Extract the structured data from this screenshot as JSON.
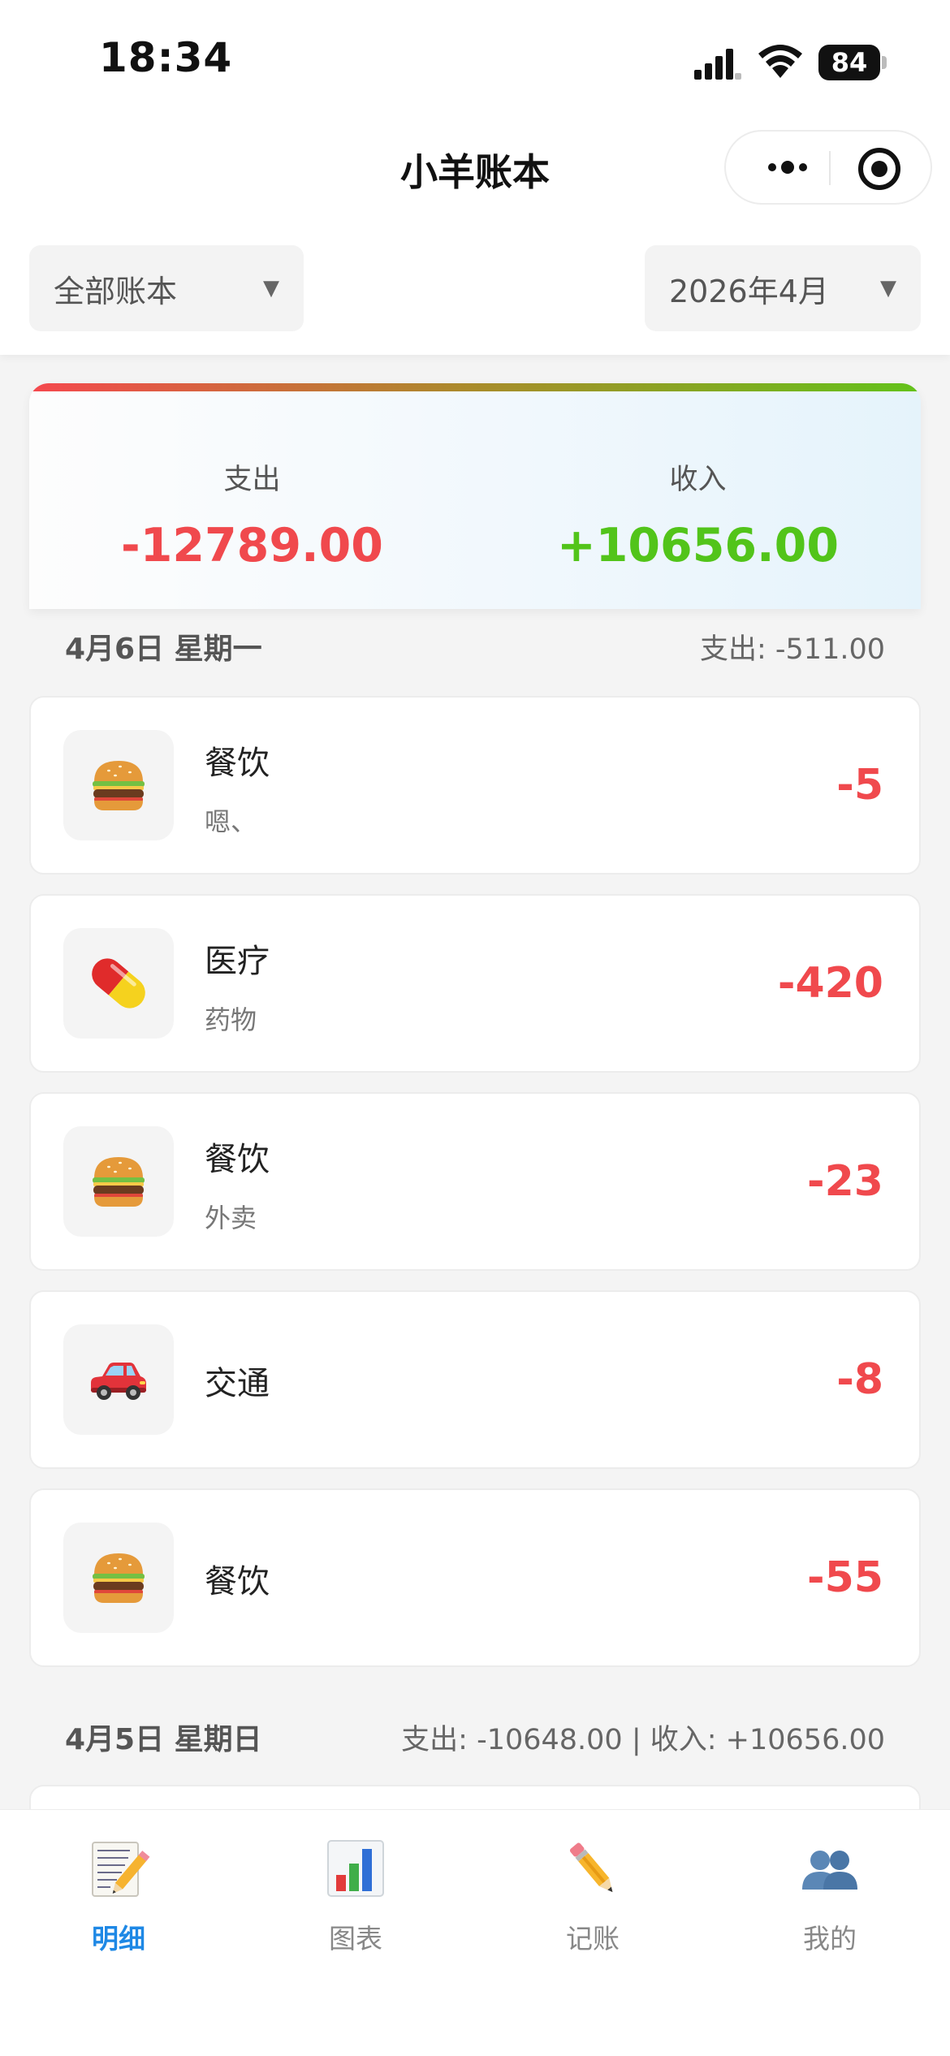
{
  "status_bar": {
    "time": "18:34",
    "battery": "84"
  },
  "nav": {
    "title": "小羊账本"
  },
  "filters": {
    "book": "全部账本",
    "month": "2026年4月"
  },
  "summary": {
    "expense_label": "支出",
    "expense_value": "-12789.00",
    "income_label": "收入",
    "income_value": "+10656.00"
  },
  "days": [
    {
      "date": "4月6日 星期一",
      "summary": "支出: -511.00",
      "records": [
        {
          "category": "餐饮",
          "note": "嗯、",
          "amount": "-5",
          "icon": "hamburger-icon"
        },
        {
          "category": "医疗",
          "note": "药物",
          "amount": "-420",
          "icon": "pill-icon"
        },
        {
          "category": "餐饮",
          "note": "外卖",
          "amount": "-23",
          "icon": "hamburger-icon"
        },
        {
          "category": "交通",
          "note": "",
          "amount": "-8",
          "icon": "car-icon"
        },
        {
          "category": "餐饮",
          "note": "",
          "amount": "-55",
          "icon": "hamburger-icon"
        }
      ]
    },
    {
      "date": "4月5日 星期日",
      "summary": "支出: -10648.00 | 收入: +10656.00",
      "records": []
    }
  ],
  "tabs": [
    {
      "label": "明细",
      "icon": "memo-icon",
      "active": true
    },
    {
      "label": "图表",
      "icon": "bar-chart-icon",
      "active": false
    },
    {
      "label": "记账",
      "icon": "pencil-icon",
      "active": false
    },
    {
      "label": "我的",
      "icon": "users-icon",
      "active": false
    }
  ],
  "colors": {
    "expense": "#f0494d",
    "income": "#52c41a",
    "active_tab": "#1e88e5"
  }
}
